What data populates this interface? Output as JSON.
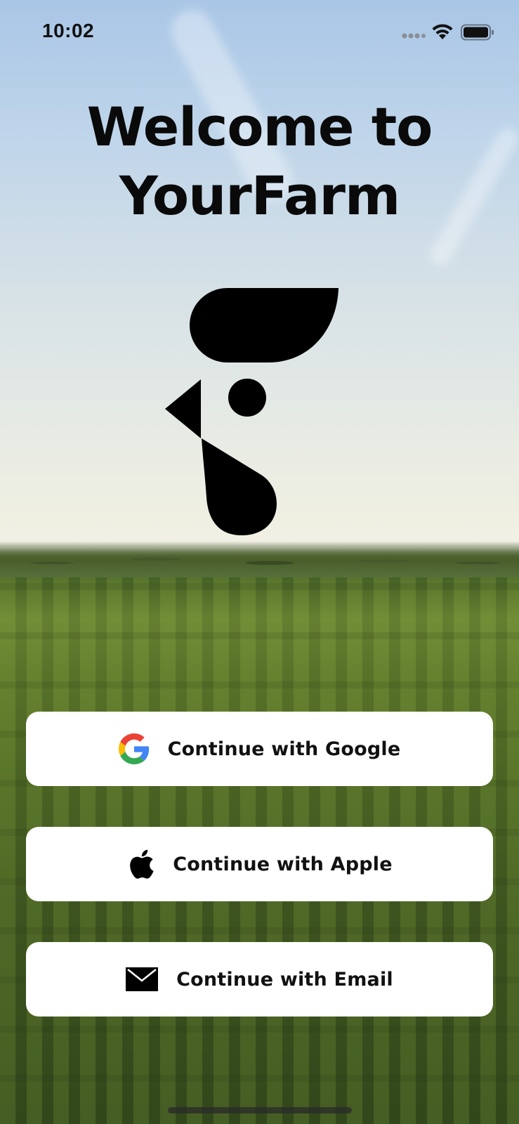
{
  "status_bar": {
    "time": "10:02",
    "icons": [
      "signal-icon",
      "wifi-icon",
      "battery-icon"
    ]
  },
  "welcome": {
    "line1": "Welcome to",
    "line2": "YourFarm"
  },
  "logo": {
    "icon": "yourfarm-logo-icon"
  },
  "auth": {
    "google": {
      "label": "Continue with Google",
      "icon": "google-icon"
    },
    "apple": {
      "label": "Continue with Apple",
      "icon": "apple-icon"
    },
    "email": {
      "label": "Continue with Email",
      "icon": "envelope-icon"
    }
  },
  "colors": {
    "text": "#0a0a0a",
    "button_bg": "#ffffff",
    "google_blue": "#4285F4",
    "google_red": "#EA4335",
    "google_yellow": "#FBBC05",
    "google_green": "#34A853"
  }
}
